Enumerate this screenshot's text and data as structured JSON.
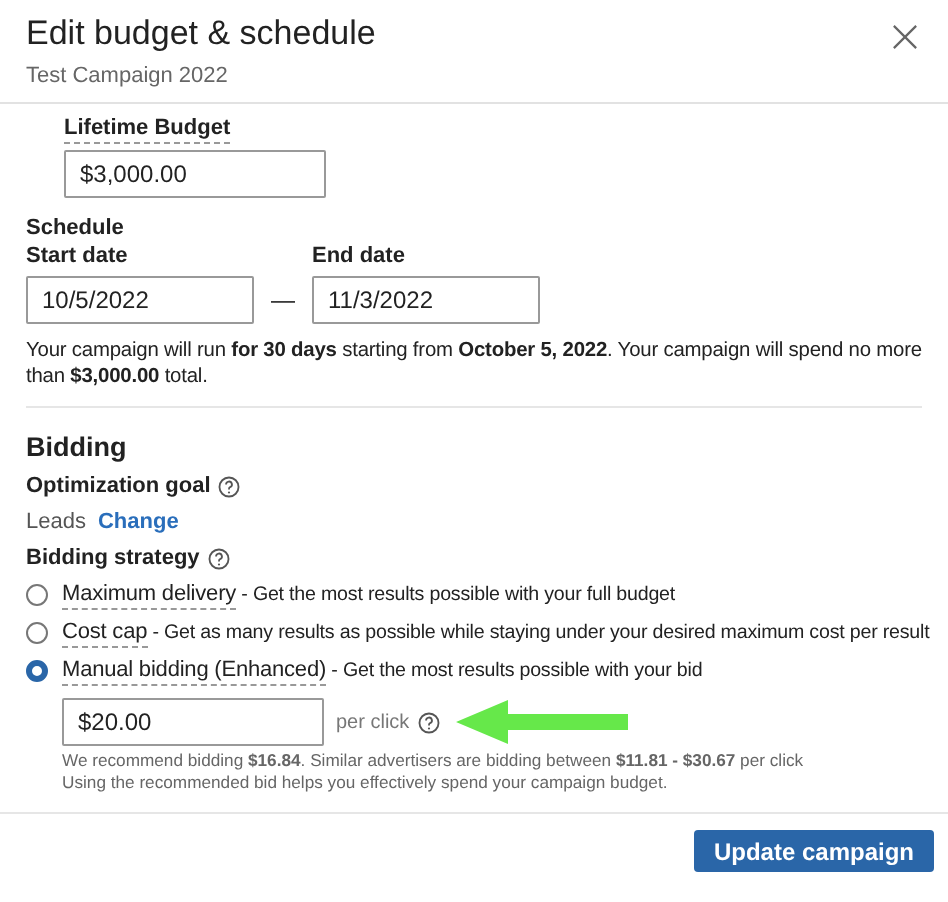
{
  "dialog": {
    "title": "Edit budget & schedule",
    "subtitle": "Test Campaign 2022"
  },
  "budget": {
    "label": "Lifetime Budget",
    "value": "$3,000.00"
  },
  "schedule": {
    "heading": "Schedule",
    "start_label": "Start date",
    "start_value": "10/5/2022",
    "separator": "—",
    "end_label": "End date",
    "end_value": "11/3/2022",
    "summary": "Your campaign will run **for 30 days** starting from **October 5, 2022**. Your campaign will spend no more than **$3,000.00** total."
  },
  "bidding": {
    "heading": "Bidding",
    "goal_label": "Optimization goal",
    "goal_value": "Leads",
    "goal_link": "Change",
    "strategy_label": "Bidding strategy",
    "options": [
      {
        "name": "Maximum delivery",
        "description": " - Get the most results possible with your full budget",
        "selected": false
      },
      {
        "name": "Cost cap",
        "description": " - Get as many results as possible while staying under your desired maximum cost per result",
        "selected": false
      },
      {
        "name": "Manual bidding (Enhanced)",
        "description": " - Get the most results possible with your bid",
        "selected": true
      }
    ],
    "bid_value": "$20.00",
    "bid_unit": "per click",
    "recommendation": "We recommend bidding **$16.84**. Similar advertisers are bidding between **$11.81 - $30.67** per click",
    "hint": "Using the recommended bid helps you effectively spend your campaign budget."
  },
  "footer": {
    "button": "Update campaign"
  }
}
